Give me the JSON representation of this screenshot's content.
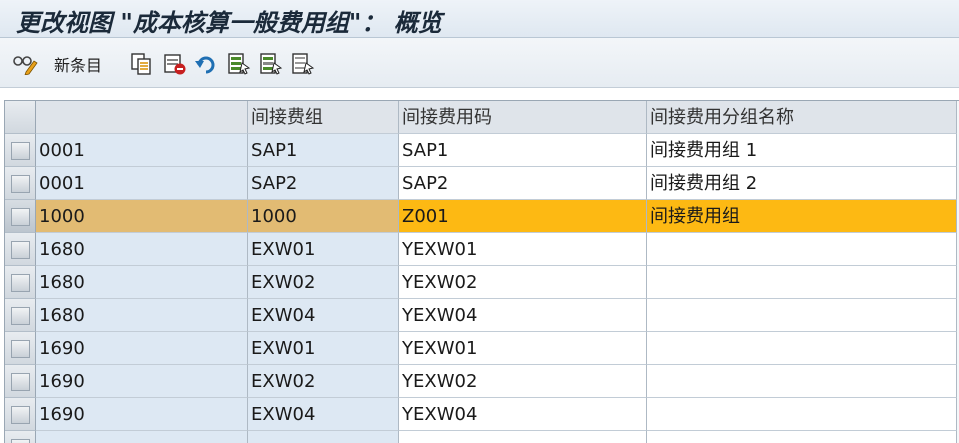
{
  "window": {
    "title": "更改视图 \"成本核算一般费用组\"： 概览"
  },
  "toolbar": {
    "new_entries_label": "新条目",
    "icons": [
      "display-change-icon",
      "copy-icon",
      "delete-icon",
      "undo-icon",
      "select-all-icon",
      "select-block-icon",
      "deselect-all-icon"
    ]
  },
  "table": {
    "columns": [
      "",
      "间接费组",
      "间接费用码",
      "间接费用分组名称"
    ],
    "rows": [
      {
        "key": "0001",
        "group": "SAP1",
        "code": "SAP1",
        "name": "间接费用组 1"
      },
      {
        "key": "0001",
        "group": "SAP2",
        "code": "SAP2",
        "name": "间接费用组 2"
      },
      {
        "key": "1000",
        "group": "1000",
        "code": "Z001",
        "name": "间接费用组"
      },
      {
        "key": "1680",
        "group": "EXW01",
        "code": "YEXW01",
        "name": ""
      },
      {
        "key": "1680",
        "group": "EXW02",
        "code": "YEXW02",
        "name": ""
      },
      {
        "key": "1680",
        "group": "EXW04",
        "code": "YEXW04",
        "name": ""
      },
      {
        "key": "1690",
        "group": "EXW01",
        "code": "YEXW01",
        "name": ""
      },
      {
        "key": "1690",
        "group": "EXW02",
        "code": "YEXW02",
        "name": ""
      },
      {
        "key": "1690",
        "group": "EXW04",
        "code": "YEXW04",
        "name": ""
      },
      {
        "key": "",
        "group": "",
        "code": "",
        "name": ""
      }
    ],
    "selected_row_index": 2
  },
  "colors": {
    "selected_row": "#fdb913",
    "selected_key": "#e2bb73",
    "key_column": "#dde8f3",
    "header": "#dfe4ea"
  }
}
